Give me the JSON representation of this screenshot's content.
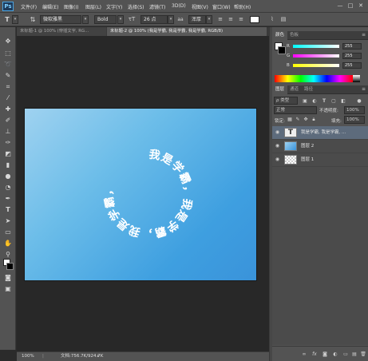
{
  "app": {
    "logo": "Ps"
  },
  "menu": {
    "items": [
      "文件(F)",
      "编辑(E)",
      "图像(I)",
      "图层(L)",
      "文字(Y)",
      "选择(S)",
      "滤镜(T)",
      "3D(D)",
      "视图(V)",
      "窗口(W)",
      "帮助(H)"
    ],
    "window_controls": [
      "—",
      "□",
      "✕"
    ]
  },
  "options": {
    "tool_icon": "T",
    "orientation_icon": "text-orientation-icon",
    "font_family": "微软雅黑",
    "font_style": "Bold",
    "size_icon": "font-size-icon",
    "font_size": "26 点",
    "aa_icon": "aa",
    "antialias": "浑厚",
    "color_swatch": "#ffffff"
  },
  "tabs": [
    {
      "label": "未标题-1 @ 100% (穿插文字, RG..."
    },
    {
      "label": "未标题-2 @ 100% (我是学霸, 我是学霸, 我是学霸, RGB/8)"
    }
  ],
  "canvas": {
    "circle_text": "我是学霸，我是学霸，我是学霸，",
    "gradient_start": "#9fd2f0",
    "gradient_end": "#3a93da"
  },
  "status": {
    "zoom": "100%",
    "doc_info": "文档:756.7K/924.7K"
  },
  "color_panel": {
    "tabs": [
      "颜色",
      "色板"
    ],
    "rows": [
      {
        "label": "R",
        "value": "255"
      },
      {
        "label": "G",
        "value": "255"
      },
      {
        "label": "B",
        "value": "255"
      }
    ]
  },
  "layers_panel": {
    "tabs": [
      "图层",
      "通道",
      "路径"
    ],
    "filter_label": "ρ 类型",
    "blend_mode": "正常",
    "opacity_label": "不透明度:",
    "opacity_value": "100%",
    "lock_label": "锁定:",
    "fill_label": "填充:",
    "fill_value": "100%",
    "layers": [
      {
        "name": "我是学霸, 我是学霸, ...",
        "kind": "text",
        "thumb": "T"
      },
      {
        "name": "图层 2",
        "kind": "gradient"
      },
      {
        "name": "图层 1",
        "kind": "transparent"
      }
    ]
  }
}
